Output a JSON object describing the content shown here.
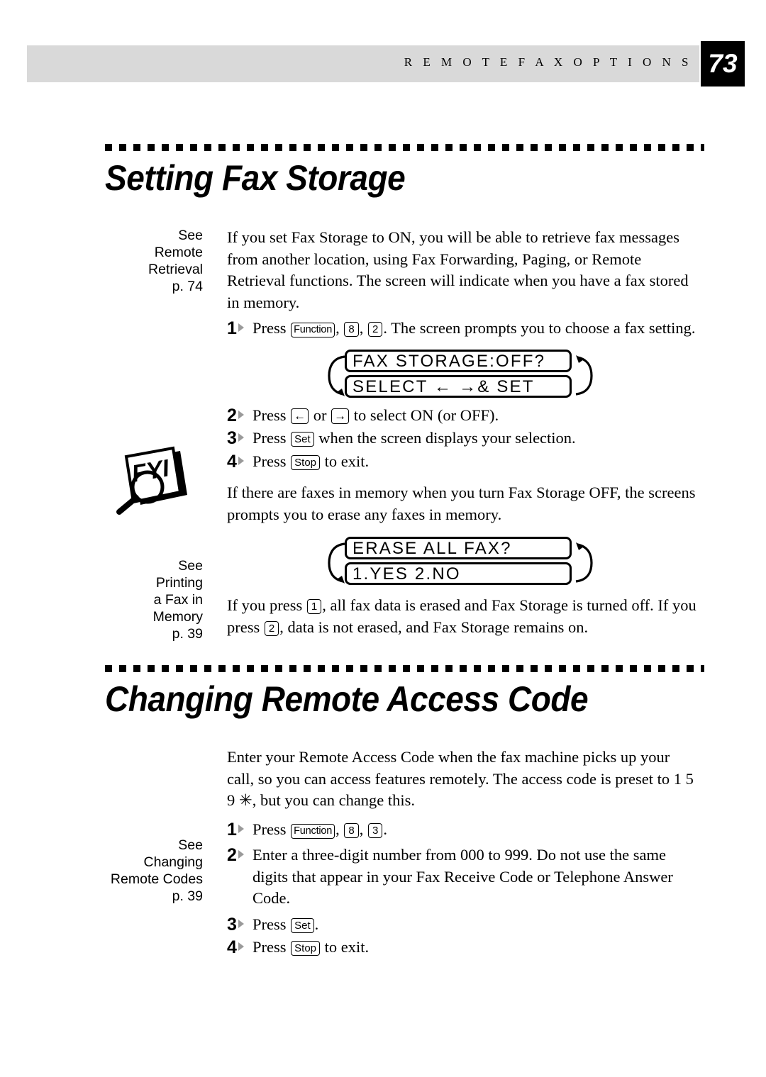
{
  "header": {
    "title": "R E M O T E   F A X   O P T I O N S",
    "page_number": "73"
  },
  "sections": [
    {
      "id": "fax-storage",
      "title": "Setting Fax Storage",
      "margin_notes": [
        {
          "lines": "See\nRemote\nRetrieval\np. 74"
        },
        {
          "lines": "See\nPrinting\na Fax in\nMemory\np. 39"
        }
      ],
      "intro": "If you set Fax Storage to ON, you will be able to retrieve fax messages from another location, using Fax Forwarding, Paging, or Remote Retrieval functions.  The screen will indicate when you have a fax stored in memory.",
      "step1": {
        "number": "1",
        "press": "Press",
        "key_function": "Function",
        "comma1": ",",
        "key_8": "8",
        "comma2": ",",
        "key_2": "2",
        "tail": ".  The screen prompts you to choose a fax setting."
      },
      "lcd1": {
        "line1": "FAX STORAGE:OFF?",
        "line2": "SELECT ← →& SET"
      },
      "step2": {
        "number": "2",
        "press": "Press",
        "key_left": "←",
        "or": "or",
        "key_right": "→",
        "tail": "to select ON (or OFF)."
      },
      "step3": {
        "number": "3",
        "press": "Press",
        "key_set": "Set",
        "tail": "when the screen displays your selection."
      },
      "step4": {
        "number": "4",
        "press": "Press",
        "key_stop": "Stop",
        "tail": "to exit."
      },
      "fyi_note": "If there are faxes in memory when you turn Fax Storage OFF, the screens prompts you to erase any faxes in memory.",
      "fyi_icon_label": "FYI",
      "lcd2": {
        "line1": "ERASE ALL FAX?",
        "line2": "1.YES 2.NO"
      },
      "outro_a": "If you press",
      "outro_key1": "1",
      "outro_b": ", all fax data is erased and Fax Storage is turned off.  If you press",
      "outro_key2": "2",
      "outro_c": ", data is not erased, and Fax Storage remains on."
    },
    {
      "id": "remote-code",
      "title": "Changing Remote Access Code",
      "margin_notes": [
        {
          "lines": "See\nChanging\nRemote Codes\np. 39"
        }
      ],
      "intro_a": "Enter your Remote Access Code when the fax machine picks up your call, so you can access features remotely.  The access code is preset to 1 5 9 ",
      "intro_asterisk": "✳",
      "intro_b": ", but you can change this.",
      "step1": {
        "number": "1",
        "press": "Press",
        "key_function": "Function",
        "comma1": ",",
        "key_8": "8",
        "comma2": ",",
        "key_3": "3",
        "tail": "."
      },
      "step2": {
        "number": "2",
        "text": "Enter a three-digit number from 000 to 999.  Do not use the same digits that appear in your Fax Receive Code or Telephone Answer Code."
      },
      "step3": {
        "number": "3",
        "press": "Press",
        "key_set": "Set",
        "tail": "."
      },
      "step4": {
        "number": "4",
        "press": "Press",
        "key_stop": "Stop",
        "tail": "to exit."
      }
    }
  ]
}
